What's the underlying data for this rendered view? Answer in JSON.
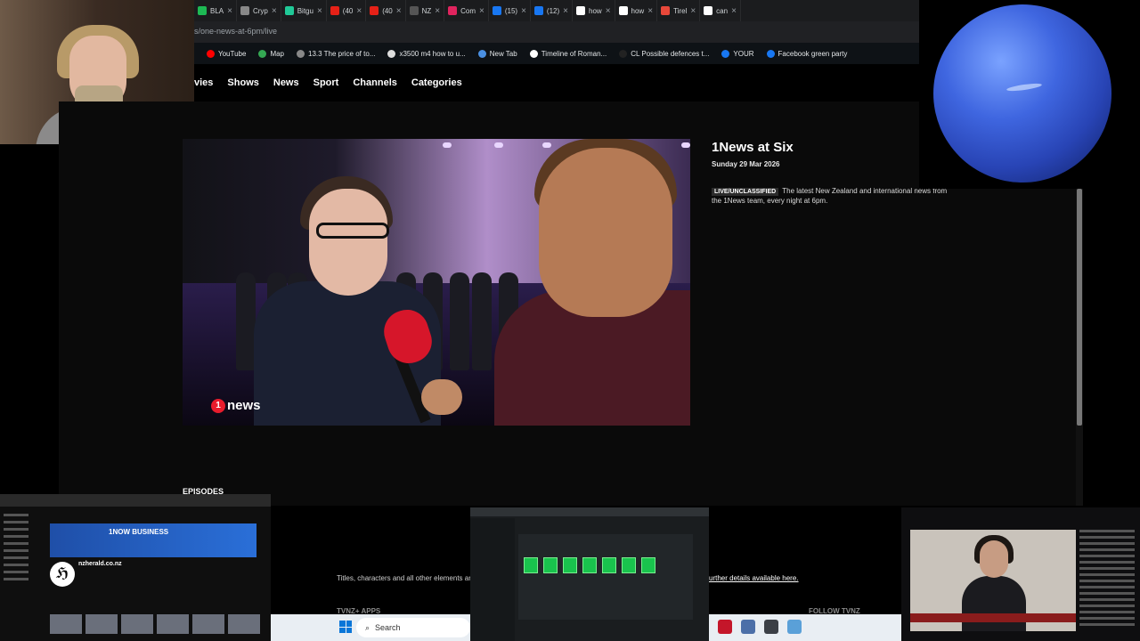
{
  "tabs": [
    {
      "label": "BLA",
      "color": "#1db954"
    },
    {
      "label": "Cryp",
      "color": "#888888"
    },
    {
      "label": "Bitgu",
      "color": "#20c997"
    },
    {
      "label": "(40",
      "color": "#e62117"
    },
    {
      "label": "(40",
      "color": "#e62117"
    },
    {
      "label": "NZ",
      "color": "#555555"
    },
    {
      "label": "Com",
      "color": "#e0245e"
    },
    {
      "label": "(15)",
      "color": "#1877f2"
    },
    {
      "label": "(12)",
      "color": "#1877f2"
    },
    {
      "label": "how",
      "color": "#ffffff"
    },
    {
      "label": "how",
      "color": "#ffffff"
    },
    {
      "label": "Tirel",
      "color": "#e8483a"
    },
    {
      "label": "can",
      "color": "#ffffff"
    }
  ],
  "address": {
    "url": "s/one-news-at-6pm/live"
  },
  "bookmarks": [
    {
      "label": "YouTube",
      "color": "#ff0000"
    },
    {
      "label": "Map",
      "color": "#34a853"
    },
    {
      "label": "13.3 The price of to...",
      "color": "#888888"
    },
    {
      "label": "x3500 m4 how to u...",
      "color": "#dddddd"
    },
    {
      "label": "New Tab",
      "color": "#4a90e2"
    },
    {
      "label": "Timeline of Roman...",
      "color": "#ffffff"
    },
    {
      "label": "CL Possible defences t...",
      "color": "#222222"
    },
    {
      "label": "YOUR",
      "color": "#1877f2"
    },
    {
      "label": "Facebook green party",
      "color": "#1877f2"
    }
  ],
  "nav": {
    "items": [
      "vies",
      "Shows",
      "News",
      "Sport",
      "Channels",
      "Categories"
    ]
  },
  "player": {
    "bug_icon_text": "1",
    "bug_text": "news"
  },
  "episode": {
    "title": "1News at Six",
    "date": "Sunday 29 Mar 2026",
    "badge": "LIVE/UNCLASSIFIED",
    "description": "The latest New Zealand and international news from the 1News team, every night at 6pm."
  },
  "page": {
    "episodes_label": "EPISODES",
    "copyright_text": "Titles, characters and all other elements are",
    "details_link": "urther details available here.",
    "apps_label": "TVNZ+ APPS",
    "follow_label": "FOLLOW TVNZ"
  },
  "taskbar": {
    "search_label": "Search"
  },
  "thumbnails": {
    "youtube_channel": "nzherald.co.nz",
    "banner": "1NOW BUSINESS"
  },
  "icons": {
    "planet": "neptune-image",
    "windows": "windows-start-icon"
  }
}
